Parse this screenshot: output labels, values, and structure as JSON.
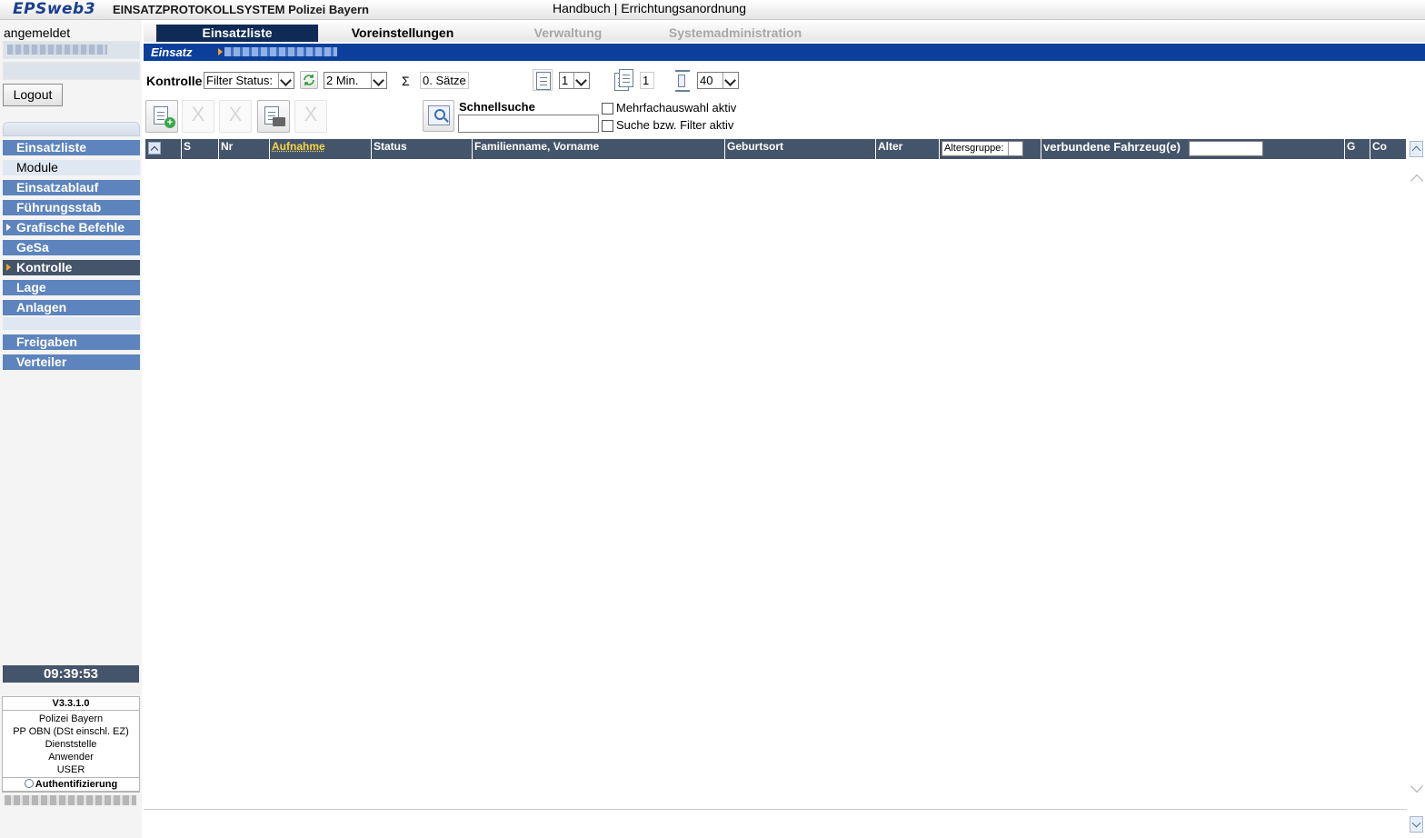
{
  "header": {
    "logo": "EPSweb3",
    "app_title": "EINSATZPROTOKOLLSYSTEM Polizei Bayern",
    "handbook": "Handbuch",
    "separator": " | ",
    "errichtung": "Errichtungsanordnung"
  },
  "sidebar": {
    "logged_in_label": "angemeldet",
    "logout": "Logout",
    "items": [
      {
        "label": "Einsatzliste"
      },
      {
        "label": "Module"
      },
      {
        "label": "Einsatzablauf"
      },
      {
        "label": "Führungsstab"
      },
      {
        "label": "Grafische Befehle"
      },
      {
        "label": "GeSa"
      },
      {
        "label": "Kontrolle"
      },
      {
        "label": "Lage"
      },
      {
        "label": "Anlagen"
      },
      {
        "label": "Freigaben"
      },
      {
        "label": "Verteiler"
      }
    ],
    "clock": "09:39:53",
    "version": "V3.3.1.0",
    "info_lines": [
      "Polizei Bayern",
      "PP OBN (DSt einschl. EZ)",
      "Dienststelle",
      "Anwender",
      "USER"
    ],
    "auth": "Authentifizierung"
  },
  "tabs": [
    {
      "label": "Einsatzliste",
      "state": "active"
    },
    {
      "label": "Voreinstellungen",
      "state": "normal"
    },
    {
      "label": "Verwaltung",
      "state": "disabled"
    },
    {
      "label": "Systemadministration",
      "state": "disabled"
    }
  ],
  "context_bar": {
    "label": "Einsatz"
  },
  "toolbar": {
    "kontrolle": "Kontrolle",
    "filter_status": "Filter Status:",
    "refresh_interval": "2 Min.",
    "sigma": "Σ",
    "count": "0. Sätze",
    "page_select": "1",
    "page_value": "1",
    "rows_select": "40"
  },
  "actions": {
    "disabled_glyph": "X",
    "quicksearch_label": "Schnellsuche",
    "multiselect_label": "Mehrfachauswahl aktiv",
    "filter_active_label": "Suche bzw. Filter aktiv"
  },
  "grid": {
    "columns": [
      "S",
      "Nr",
      "Aufnahme",
      "Status",
      "Familienname, Vorname",
      "Geburtsort",
      "Alter",
      "",
      "verbundene Fahrzeug(e)",
      "G",
      "Co"
    ],
    "altersgruppe": "Altersgruppe:"
  },
  "colors": {
    "nav_blue": "#5d84bd",
    "nav_dark": "#44546a",
    "context_blue": "#0c3f9c",
    "tab_active": "#0f2a55"
  }
}
